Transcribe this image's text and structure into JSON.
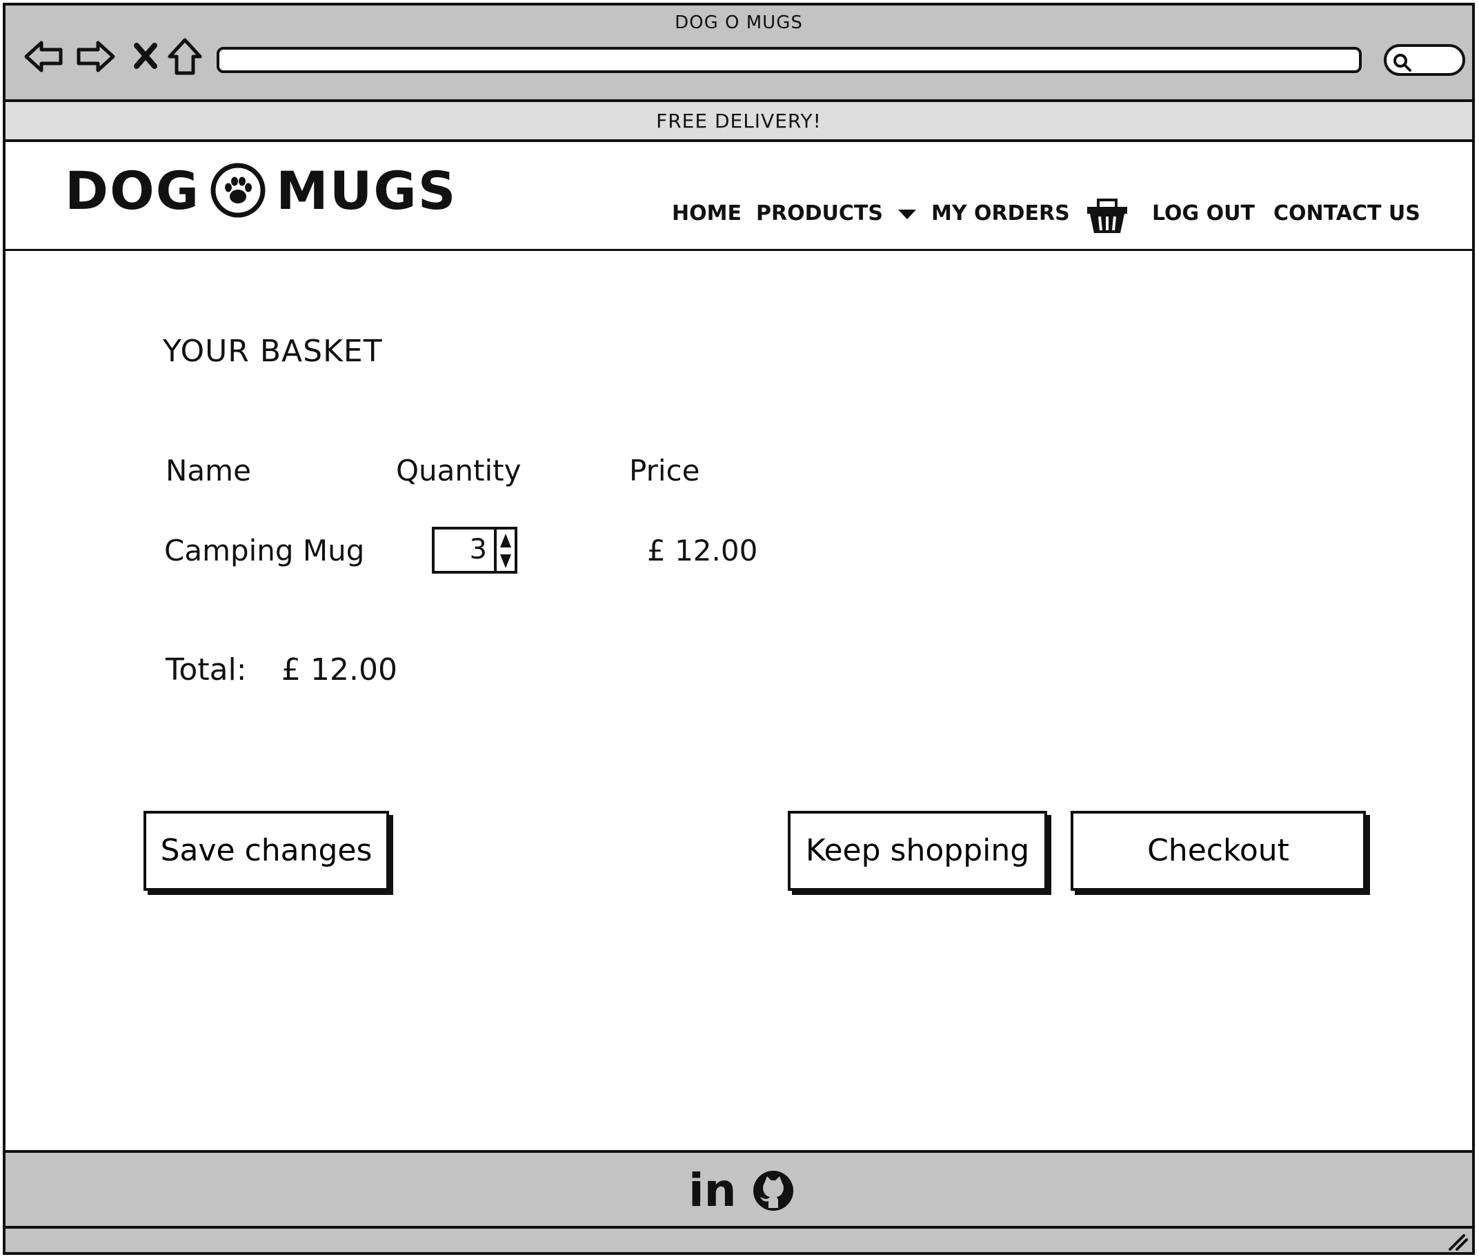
{
  "browser": {
    "window_title": "DOG O MUGS",
    "url": ""
  },
  "promo_banner": "FREE DELIVERY!",
  "header": {
    "logo_left": "DOG",
    "logo_right": "MUGS",
    "logo_icon": "paw-icon",
    "nav": {
      "home": "HOME",
      "products": "PRODUCTS",
      "my_orders": "MY ORDERS",
      "log_out": "LOG OUT",
      "contact_us": "CONTACT US"
    }
  },
  "basket": {
    "title": "YOUR BASKET",
    "columns": [
      "Name",
      "Quantity",
      "Price"
    ],
    "rows": [
      {
        "name": "Camping Mug",
        "quantity": "3",
        "price": "£ 12.00"
      }
    ],
    "total_label": "Total:",
    "total_value": "£ 12.00"
  },
  "actions": {
    "save": "Save changes",
    "keep_shopping": "Keep shopping",
    "checkout": "Checkout"
  },
  "footer": {
    "icons": [
      "linkedin-icon",
      "github-icon"
    ],
    "linkedin_text": "in"
  }
}
